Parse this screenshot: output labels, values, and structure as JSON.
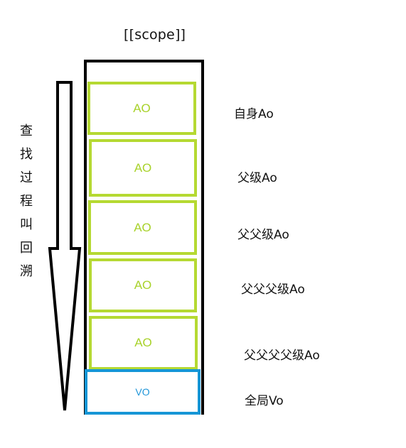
{
  "scope_label": "[[scope]]",
  "process_label": [
    "查",
    "找",
    "过",
    "程",
    "叫",
    "回",
    "溯"
  ],
  "stack": [
    {
      "label": "AO",
      "kind": "ao",
      "side_label": "自身Ao"
    },
    {
      "label": "AO",
      "kind": "ao",
      "side_label": "父级Ao"
    },
    {
      "label": "AO",
      "kind": "ao",
      "side_label": "父父级Ao"
    },
    {
      "label": "AO",
      "kind": "ao",
      "side_label": "父父父级Ao"
    },
    {
      "label": "AO",
      "kind": "ao",
      "side_label": "父父父父级Ao"
    },
    {
      "label": "VO",
      "kind": "vo",
      "side_label": "全局Vo"
    }
  ],
  "colors": {
    "ao_border": "#b5d932",
    "ao_text": "#a8d22a",
    "vo_border": "#1696d6",
    "vo_text": "#1f95d8",
    "outline": "#000000"
  }
}
